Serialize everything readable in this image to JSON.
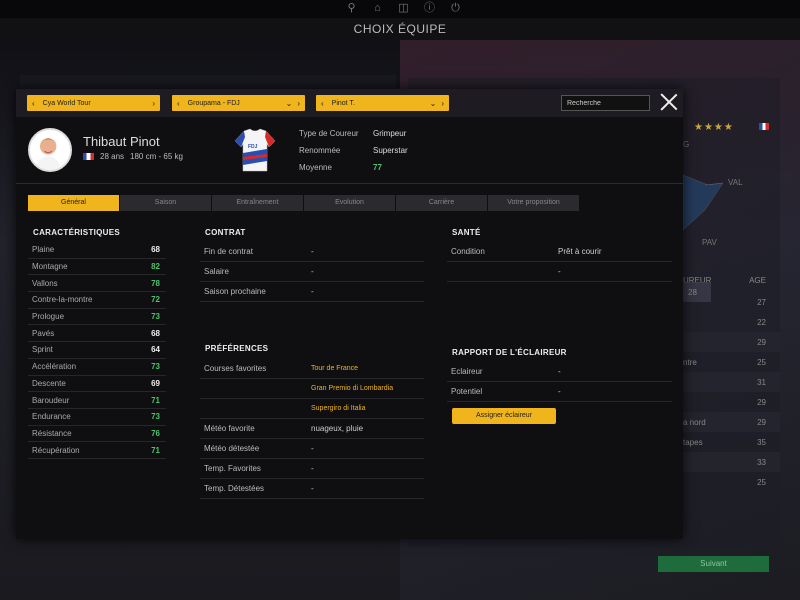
{
  "window": {
    "title": "CHOIX ÉQUIPE"
  },
  "top_icons": [
    "bell-icon",
    "home-icon",
    "gamepad-icon",
    "info-icon",
    "power-icon"
  ],
  "filters": {
    "tour": "Cya World Tour",
    "team": "Groupama - FDJ",
    "rider": "Pinot T."
  },
  "search": {
    "value": "Recherche"
  },
  "player": {
    "name": "Thibaut Pinot",
    "age": "28 ans",
    "height_weight": "180 cm - 65 kg",
    "attributes": [
      {
        "label": "Type de Coureur",
        "value": "Grimpeur",
        "color": "white"
      },
      {
        "label": "Renommée",
        "value": "Superstar",
        "color": "white"
      },
      {
        "label": "Moyenne",
        "value": "77",
        "color": "green"
      }
    ]
  },
  "tabs": [
    {
      "label": "Général",
      "active": true
    },
    {
      "label": "Saison",
      "active": false
    },
    {
      "label": "Entraînement",
      "active": false
    },
    {
      "label": "Evolution",
      "active": false
    },
    {
      "label": "Carrière",
      "active": false
    },
    {
      "label": "Votre proposition",
      "active": false
    }
  ],
  "characteristics": {
    "title": "CARACTÉRISTIQUES",
    "rows": [
      {
        "label": "Plaine",
        "value": "68",
        "color": "white"
      },
      {
        "label": "Montagne",
        "value": "82",
        "color": "green"
      },
      {
        "label": "Vallons",
        "value": "78",
        "color": "green"
      },
      {
        "label": "Contre-la-montre",
        "value": "72",
        "color": "green"
      },
      {
        "label": "Prologue",
        "value": "73",
        "color": "green"
      },
      {
        "label": "Pavés",
        "value": "68",
        "color": "white"
      },
      {
        "label": "Sprint",
        "value": "64",
        "color": "white"
      },
      {
        "label": "Accélération",
        "value": "73",
        "color": "green"
      },
      {
        "label": "Descente",
        "value": "69",
        "color": "white"
      },
      {
        "label": "Baroudeur",
        "value": "71",
        "color": "green"
      },
      {
        "label": "Endurance",
        "value": "73",
        "color": "green"
      },
      {
        "label": "Résistance",
        "value": "76",
        "color": "green"
      },
      {
        "label": "Récupération",
        "value": "71",
        "color": "green"
      }
    ]
  },
  "contract": {
    "title": "CONTRAT",
    "rows": [
      {
        "label": "Fin de contrat",
        "value": "-"
      },
      {
        "label": "Salaire",
        "value": "-"
      },
      {
        "label": "Saison prochaine",
        "value": "-"
      }
    ]
  },
  "preferences": {
    "title": "PRÉFÉRENCES",
    "favorite_races_label": "Courses favorites",
    "favorite_races": [
      "Tour de France",
      "Gran Premio di Lombardia",
      "Supergiro di Italia"
    ],
    "rows": [
      {
        "label": "Météo favorite",
        "value": "nuageux, pluie"
      },
      {
        "label": "Météo détestée",
        "value": "-"
      },
      {
        "label": "Temp. Favorites",
        "value": "-"
      },
      {
        "label": "Temp. Détestées",
        "value": "-"
      }
    ]
  },
  "health": {
    "title": "SANTÉ",
    "rows": [
      {
        "label": "Condition",
        "value": "Prêt à courir"
      },
      {
        "label": "",
        "value": "-"
      }
    ]
  },
  "scout": {
    "title": "RAPPORT DE L'ÉCLAIREUR",
    "rows": [
      {
        "label": "Eclaireur",
        "value": "-"
      },
      {
        "label": "Potentiel",
        "value": "-"
      }
    ],
    "button": "Assigner éclaireur"
  },
  "background": {
    "radar_labels": [
      "G",
      "VAL",
      "PAV"
    ],
    "list_header": {
      "col1": "UREUR",
      "col2": "AGE"
    },
    "list_rows": [
      {
        "name": "",
        "age": "27"
      },
      {
        "name": "",
        "age": "28"
      },
      {
        "name": "",
        "age": "22"
      },
      {
        "name": "",
        "age": "29"
      },
      {
        "name": "ntre",
        "age": "25"
      },
      {
        "name": "",
        "age": "31"
      },
      {
        "name": "",
        "age": "29"
      },
      {
        "name": "a nord",
        "age": "29"
      },
      {
        "name": "tapes",
        "age": "35"
      },
      {
        "name": "",
        "age": "33"
      },
      {
        "name": "",
        "age": "25"
      }
    ],
    "next_button": "Suivant"
  },
  "colors": {
    "accent": "#f0b41c",
    "green": "#4dc36b",
    "bg": "#0f0f12"
  }
}
